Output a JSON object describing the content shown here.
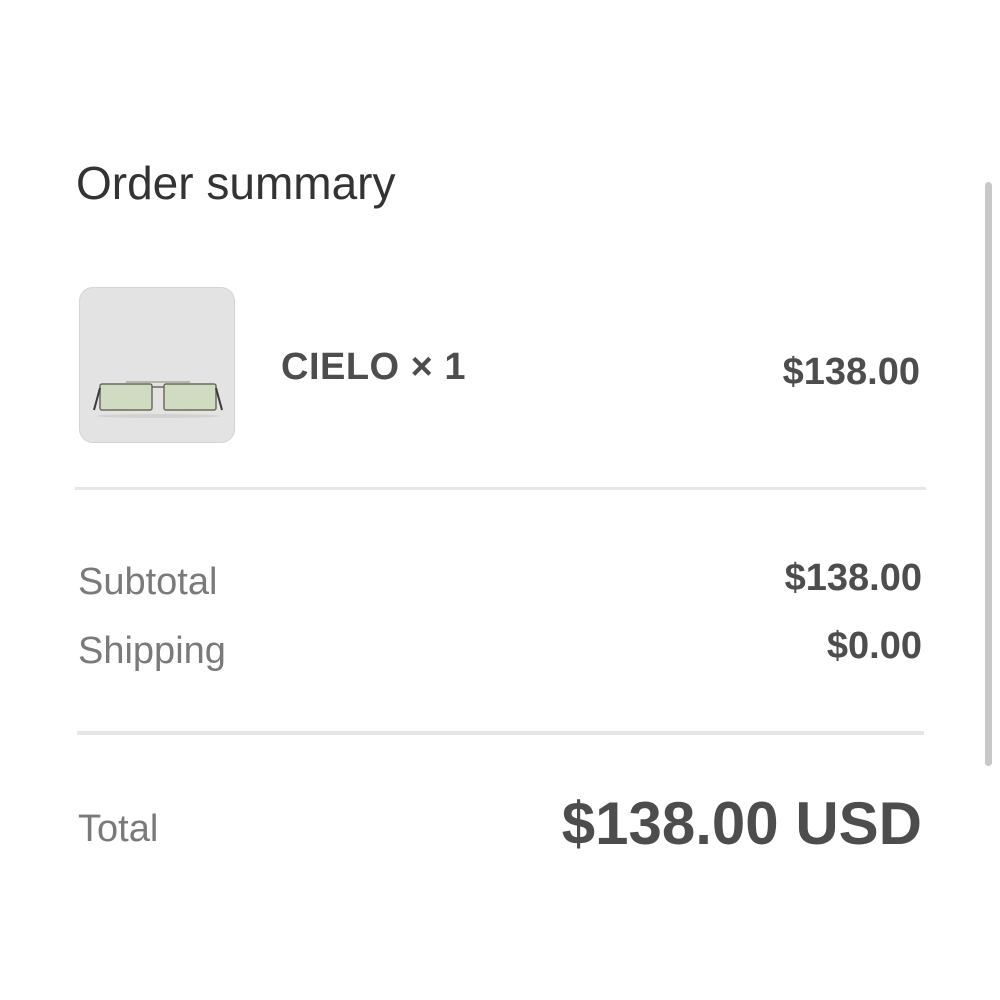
{
  "summary": {
    "title": "Order summary"
  },
  "item": {
    "image_icon": "sunglasses-image",
    "name": "CIELO × 1",
    "price": "$138.00"
  },
  "totals": {
    "subtotal_label": "Subtotal",
    "subtotal_value": "$138.00",
    "shipping_label": "Shipping",
    "shipping_value": "$0.00",
    "total_label": "Total",
    "total_value": "$138.00 USD"
  },
  "colors": {
    "text_dark": "#333333",
    "text_muted": "#7a7a7a",
    "divider": "#e6e6e6",
    "thumb_bg": "#e3e3e3"
  }
}
